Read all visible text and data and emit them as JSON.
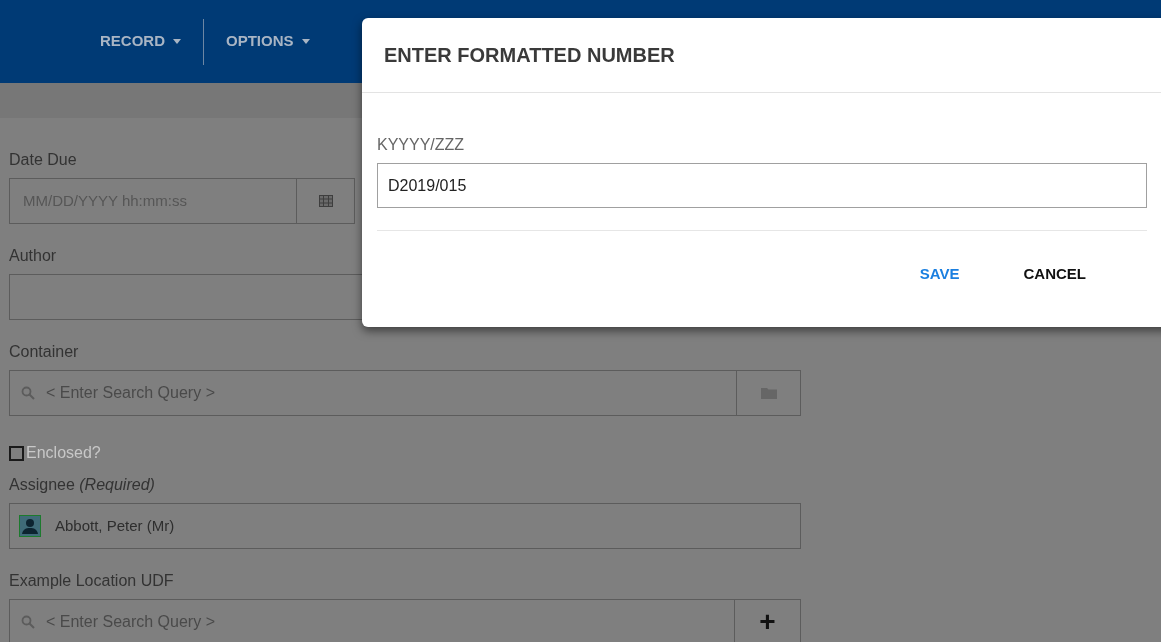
{
  "header": {
    "menus": [
      {
        "label": "RECORD"
      },
      {
        "label": "OPTIONS"
      }
    ]
  },
  "form": {
    "fields": [
      {
        "kind": "date",
        "label": "Date Due",
        "placeholder": "MM/DD/YYYY hh:mm:ss"
      },
      {
        "kind": "text",
        "label": "Author"
      },
      {
        "kind": "search",
        "label": "Container",
        "placeholder": "< Enter Search Query >"
      },
      {
        "kind": "checkbox",
        "label": "Enclosed?",
        "checked": false
      },
      {
        "kind": "person",
        "label": "Assignee *(Required)*",
        "value": "Abbott, Peter (Mr)"
      },
      {
        "kind": "search_add",
        "label": "Example Location UDF",
        "placeholder": "< Enter Search Query >",
        "button_label": "+"
      }
    ]
  },
  "dialog": {
    "title": "ENTER FORMATTED NUMBER",
    "field_label": "KYYYY/ZZZ",
    "value": "D2019/015",
    "buttons": [
      {
        "label": "SAVE",
        "kind": "primary"
      },
      {
        "label": "CANCEL",
        "kind": "secondary"
      }
    ]
  }
}
